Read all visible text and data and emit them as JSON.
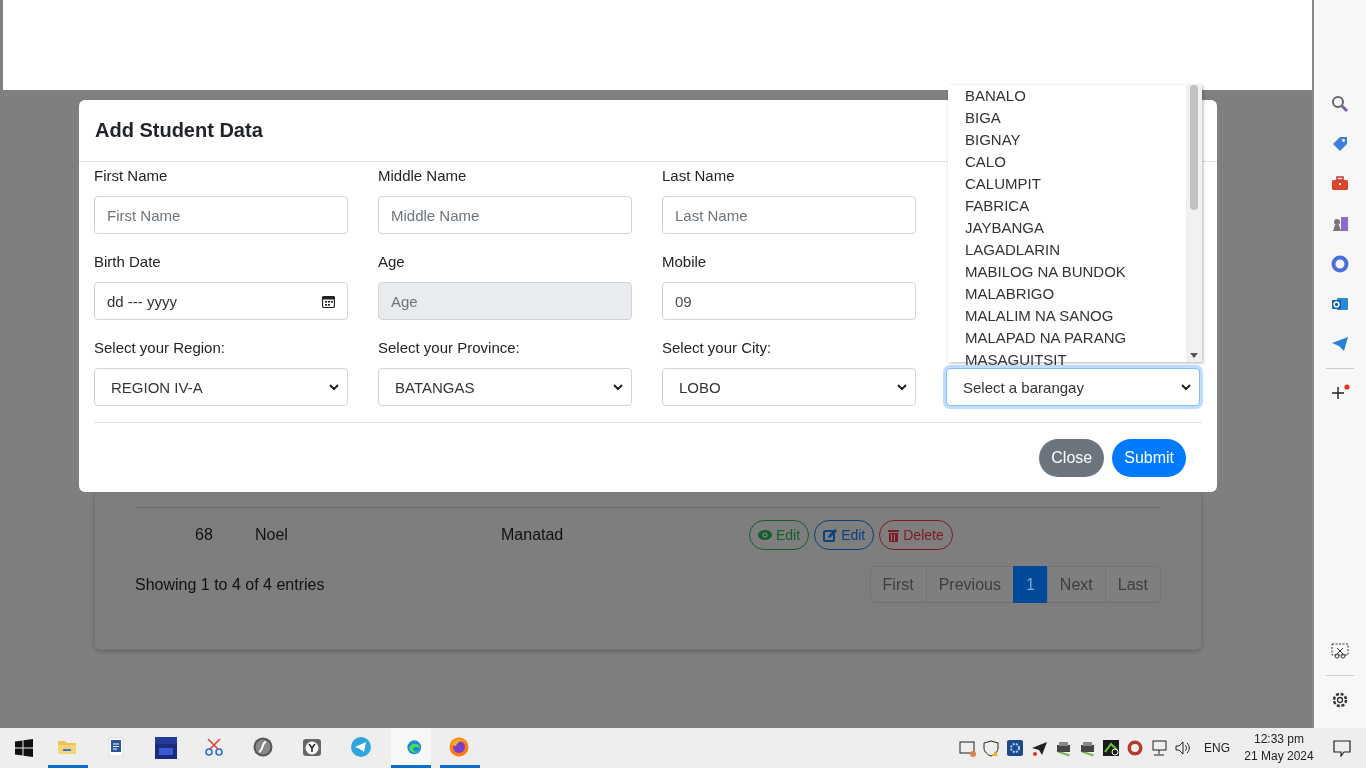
{
  "table": {
    "rows": [
      {
        "cells": [
          "68",
          "Noel",
          "Manatad"
        ],
        "actions": [
          {
            "kind": "view",
            "label": "Edit"
          },
          {
            "kind": "edit",
            "label": "Edit"
          },
          {
            "kind": "delete",
            "label": "Delete"
          }
        ]
      }
    ],
    "summary": "Showing 1 to 4 of 4 entries",
    "pagination": [
      {
        "label": "First",
        "selected": false
      },
      {
        "label": "Previous",
        "selected": false
      },
      {
        "label": "1",
        "selected": true
      },
      {
        "label": "Next",
        "selected": false
      },
      {
        "label": "Last",
        "selected": false
      }
    ]
  },
  "modal": {
    "title": "Add Student Data",
    "fields": [
      {
        "kind": "text",
        "label": "First Name",
        "placeholder": "First Name",
        "disabled": false,
        "focused": false
      },
      {
        "kind": "text",
        "label": "Middle Name",
        "placeholder": "Middle Name",
        "disabled": false,
        "focused": false
      },
      {
        "kind": "text",
        "label": "Last Name",
        "placeholder": "Last Name",
        "disabled": false,
        "focused": false
      },
      {
        "kind": "blank"
      },
      {
        "kind": "date",
        "label": "Birth Date",
        "value": "dd --- yyyy",
        "disabled": false,
        "focused": false
      },
      {
        "kind": "text",
        "label": "Age",
        "placeholder": "Age",
        "disabled": true,
        "focused": false
      },
      {
        "kind": "text",
        "label": "Mobile",
        "value": "09",
        "disabled": false,
        "focused": false
      },
      {
        "kind": "blank"
      },
      {
        "kind": "select",
        "label": "Select your Region:",
        "value": "REGION IV-A",
        "disabled": false,
        "focused": false
      },
      {
        "kind": "select",
        "label": "Select your Province:",
        "value": "BATANGAS",
        "disabled": false,
        "focused": false
      },
      {
        "kind": "select",
        "label": "Select your City:",
        "value": "LOBO",
        "disabled": false,
        "focused": false
      },
      {
        "kind": "select",
        "value": "Select a barangay",
        "disabled": false,
        "focused": true
      }
    ],
    "buttons": [
      {
        "kind": "secondary",
        "label": "Close"
      },
      {
        "kind": "primary",
        "label": "Submit"
      }
    ]
  },
  "dropdown": {
    "options": [
      "BANALO",
      "BIGA",
      "BIGNAY",
      "CALO",
      "CALUMPIT",
      "FABRICA",
      "JAYBANGA",
      "LAGADLARIN",
      "MABILOG NA BUNDOK",
      "MALABRIGO",
      "MALALIM NA SANOG",
      "MALAPAD NA PARANG",
      "MASAGUITSIT"
    ]
  },
  "taskbar": {
    "apps": [
      {
        "kind": "folder",
        "running": true,
        "selected": false
      },
      {
        "kind": "document",
        "running": false,
        "selected": false
      },
      {
        "kind": "dsp",
        "running": false,
        "selected": false
      },
      {
        "kind": "scissors",
        "running": false,
        "selected": false
      },
      {
        "kind": "flash",
        "running": false,
        "selected": false
      },
      {
        "kind": "clock",
        "running": false,
        "selected": false
      },
      {
        "kind": "telegram",
        "running": false,
        "selected": false
      },
      {
        "kind": "edge",
        "running": true,
        "selected": true
      },
      {
        "kind": "firefox",
        "running": true,
        "selected": false
      }
    ],
    "language": "ENG",
    "time": "12:33 pm",
    "date": "21 May 2024"
  }
}
